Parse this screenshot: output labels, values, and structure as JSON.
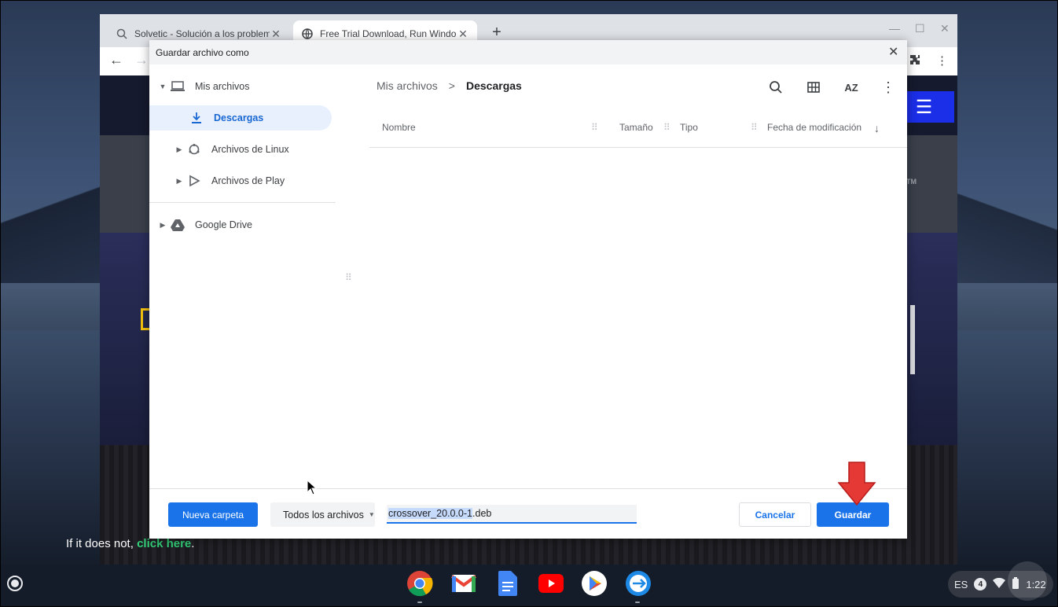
{
  "browser": {
    "tabs": [
      {
        "title": "Solvetic - Solución a los problem",
        "icon": "search-icon"
      },
      {
        "title": "Free Trial Download, Run Windo",
        "icon": "globe-icon"
      }
    ],
    "new_tab": "+",
    "minimize": "—",
    "maximize": "☐",
    "close": "✕"
  },
  "page": {
    "redirect_text": "If it does not, ",
    "redirect_link": "click here",
    "redirect_end": ".",
    "tm": "TM"
  },
  "dialog": {
    "title": "Guardar archivo como",
    "close": "✕",
    "sidebar": {
      "my_files": "Mis archivos",
      "downloads": "Descargas",
      "linux_files": "Archivos de Linux",
      "play_files": "Archivos de Play",
      "google_drive": "Google Drive"
    },
    "breadcrumb": {
      "root": "Mis archivos",
      "sep": ">",
      "current": "Descargas"
    },
    "columns": {
      "name": "Nombre",
      "size": "Tamaño",
      "type": "Tipo",
      "modified": "Fecha de modificación"
    },
    "sort_label": "AZ",
    "footer": {
      "new_folder": "Nueva carpeta",
      "file_type": "Todos los archivos",
      "filename_selected": "crossover_20.0.0-1",
      "filename_ext": ".deb",
      "cancel": "Cancelar",
      "save": "Guardar"
    }
  },
  "shelf": {
    "apps": [
      "chrome-icon",
      "gmail-icon",
      "docs-icon",
      "youtube-icon",
      "play-store-icon",
      "crossover-icon"
    ],
    "tray": {
      "lang": "ES",
      "notifications": "4",
      "time": "1:22"
    }
  },
  "colors": {
    "accent": "#1a73e8",
    "selected_bg": "#e8f0fe",
    "arrow": "#e53935"
  }
}
